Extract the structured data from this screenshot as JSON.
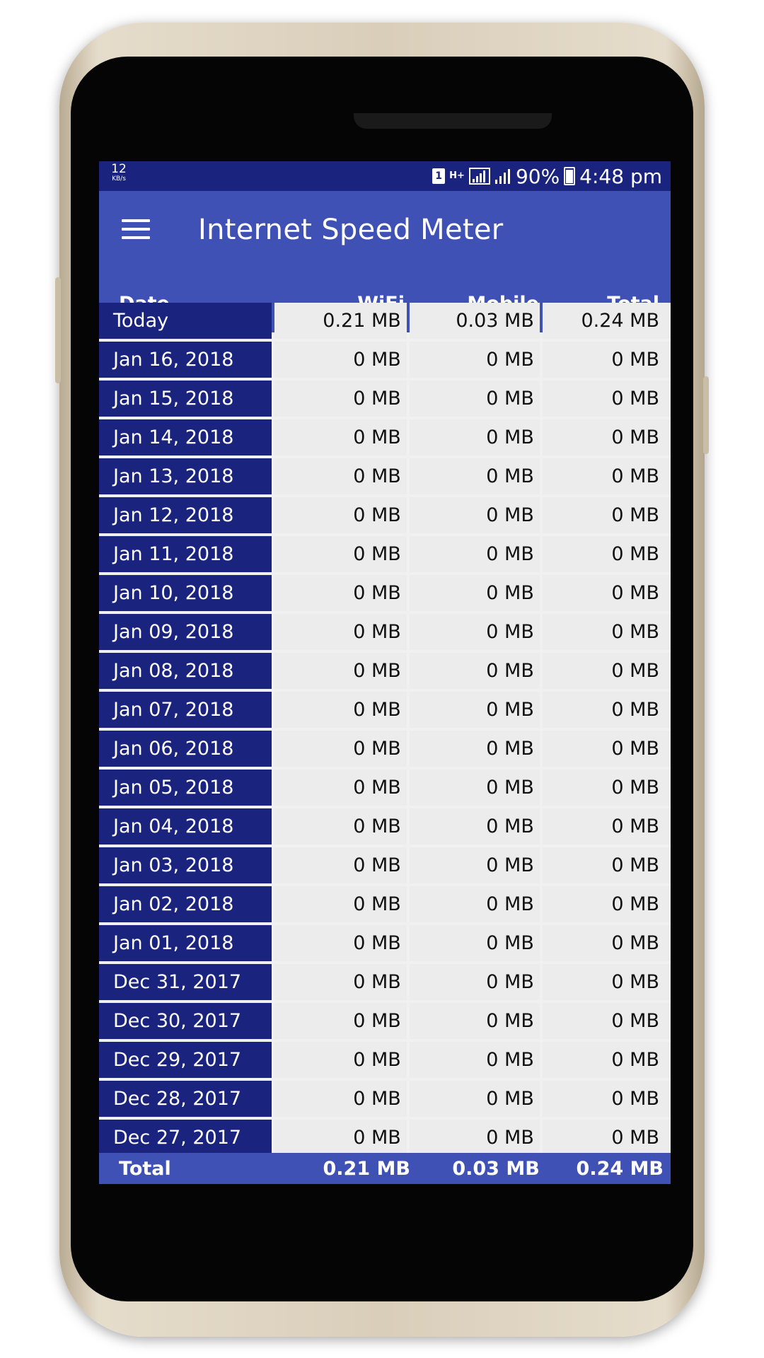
{
  "status_bar": {
    "speed_value": "12",
    "speed_unit": "KB/s",
    "sim_label": "1",
    "network_type": "H+",
    "battery": "90%",
    "time": "4:48 pm"
  },
  "app_bar": {
    "title": "Internet Speed Meter",
    "menu_icon": "hamburger-menu-icon"
  },
  "table": {
    "headers": {
      "date": "Date",
      "wifi": "WiFi",
      "mobile": "Mobile",
      "total": "Total"
    },
    "rows": [
      {
        "date": "Today",
        "wifi": "0.21 MB",
        "mobile": "0.03 MB",
        "total": "0.24 MB"
      },
      {
        "date": "Jan 16, 2018",
        "wifi": "0 MB",
        "mobile": "0 MB",
        "total": "0 MB"
      },
      {
        "date": "Jan 15, 2018",
        "wifi": "0 MB",
        "mobile": "0 MB",
        "total": "0 MB"
      },
      {
        "date": "Jan 14, 2018",
        "wifi": "0 MB",
        "mobile": "0 MB",
        "total": "0 MB"
      },
      {
        "date": "Jan 13, 2018",
        "wifi": "0 MB",
        "mobile": "0 MB",
        "total": "0 MB"
      },
      {
        "date": "Jan 12, 2018",
        "wifi": "0 MB",
        "mobile": "0 MB",
        "total": "0 MB"
      },
      {
        "date": "Jan 11, 2018",
        "wifi": "0 MB",
        "mobile": "0 MB",
        "total": "0 MB"
      },
      {
        "date": "Jan 10, 2018",
        "wifi": "0 MB",
        "mobile": "0 MB",
        "total": "0 MB"
      },
      {
        "date": "Jan 09, 2018",
        "wifi": "0 MB",
        "mobile": "0 MB",
        "total": "0 MB"
      },
      {
        "date": "Jan 08, 2018",
        "wifi": "0 MB",
        "mobile": "0 MB",
        "total": "0 MB"
      },
      {
        "date": "Jan 07, 2018",
        "wifi": "0 MB",
        "mobile": "0 MB",
        "total": "0 MB"
      },
      {
        "date": "Jan 06, 2018",
        "wifi": "0 MB",
        "mobile": "0 MB",
        "total": "0 MB"
      },
      {
        "date": "Jan 05, 2018",
        "wifi": "0 MB",
        "mobile": "0 MB",
        "total": "0 MB"
      },
      {
        "date": "Jan 04, 2018",
        "wifi": "0 MB",
        "mobile": "0 MB",
        "total": "0 MB"
      },
      {
        "date": "Jan 03, 2018",
        "wifi": "0 MB",
        "mobile": "0 MB",
        "total": "0 MB"
      },
      {
        "date": "Jan 02, 2018",
        "wifi": "0 MB",
        "mobile": "0 MB",
        "total": "0 MB"
      },
      {
        "date": "Jan 01, 2018",
        "wifi": "0 MB",
        "mobile": "0 MB",
        "total": "0 MB"
      },
      {
        "date": "Dec 31, 2017",
        "wifi": "0 MB",
        "mobile": "0 MB",
        "total": "0 MB"
      },
      {
        "date": "Dec 30, 2017",
        "wifi": "0 MB",
        "mobile": "0 MB",
        "total": "0 MB"
      },
      {
        "date": "Dec 29, 2017",
        "wifi": "0 MB",
        "mobile": "0 MB",
        "total": "0 MB"
      },
      {
        "date": "Dec 28, 2017",
        "wifi": "0 MB",
        "mobile": "0 MB",
        "total": "0 MB"
      },
      {
        "date": "Dec 27, 2017",
        "wifi": "0 MB",
        "mobile": "0 MB",
        "total": "0 MB"
      }
    ],
    "footer": {
      "label": "Total",
      "wifi": "0.21 MB",
      "mobile": "0.03 MB",
      "total": "0.24 MB"
    }
  },
  "colors": {
    "status_bar": "#1a237e",
    "app_bar": "#3f51b5",
    "date_cell": "#1a237e",
    "value_cell": "#ececec"
  }
}
